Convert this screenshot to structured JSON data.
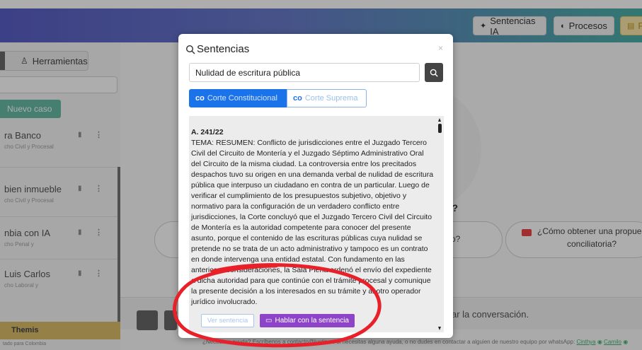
{
  "header": {
    "sentencias_button": "Sentencias IA",
    "procesos_button": "Procesos",
    "partial_button": "P"
  },
  "sidebar": {
    "tools_button": "Herramientas",
    "new_case_button": "Nuevo caso",
    "cases": [
      {
        "title": "ra Banco",
        "subtitle": "cho Civil y Procesal"
      },
      {
        "title": "bien inmueble",
        "subtitle": "cho Civil y Procesal"
      },
      {
        "title": "nbia con IA",
        "subtitle": "cho Penal y"
      },
      {
        "title": "Luis Carlos",
        "subtitle": "cho Laboral y"
      }
    ],
    "brand": "Themis",
    "brand_sub": "tado para Colombia"
  },
  "main": {
    "question_suffix": "in?",
    "card_mid": "o?",
    "card_right_line1": "¿Cómo obtener una propuesta",
    "card_right_line2": "conciliatoria?",
    "chat_placeholder": "ar la conversación.",
    "footer_text": "¿Necesitas ayuda? Escríbenos a contacto@lustin.co si necesitas alguna ayuda, o no dudes en contactar a alguien de nuestro equipo por whatsApp:",
    "footer_link1": "Cinthya",
    "footer_link2": "Camilo"
  },
  "modal": {
    "title": "Sentencias",
    "close": "×",
    "search_value": "Nulidad de escritura pública",
    "tabs": [
      {
        "prefix": "co",
        "label": "Corte Constitucional",
        "active": true
      },
      {
        "prefix": "co",
        "label": "Corte Suprema",
        "active": false
      }
    ],
    "result": {
      "id": "A. 241/22",
      "text": "TEMA: RESUMEN: Conflicto de jurisdicciones entre el Juzgado Tercero Civil del Circuito de Montería y el Juzgado Séptimo Administrativo Oral del Circuito de la misma ciudad. La controversia entre los precitados despachos tuvo su origen en una demanda verbal de nulidad de escritura pública que interpuso un ciudadano en contra de un particular. Luego de verificar el cumplimiento de los presupuestos subjetivo, objetivo y normativo para la configuración de un verdadero conflicto entre jurisdicciones, la Corte concluyó que el Juzgado Tercero Civil del Circuito de Montería es la autoridad competente para conocer del presente asunto, porque el contenido de las escrituras públicas cuya nulidad se pretende no se trata de un acto administrativo y tampoco es un contrato en donde intervenga una entidad estatal. Con fundamento en las anteriores consideraciones, la Sala Plena ordenó el envío del expediente a dicha autoridad para que continúe con el trámite procesal y comunique la presente decisión a los interesados en su trámite y al otro operador jurídico involucrado."
    },
    "view_button": "Ver sentencia",
    "talk_button": "Hablar con la sentencia"
  },
  "colors": {
    "accent_blue": "#1a73e8",
    "talk_purple": "#8e44c9",
    "annotation_red": "#e8202a",
    "brand_gold": "#d9b75c"
  }
}
